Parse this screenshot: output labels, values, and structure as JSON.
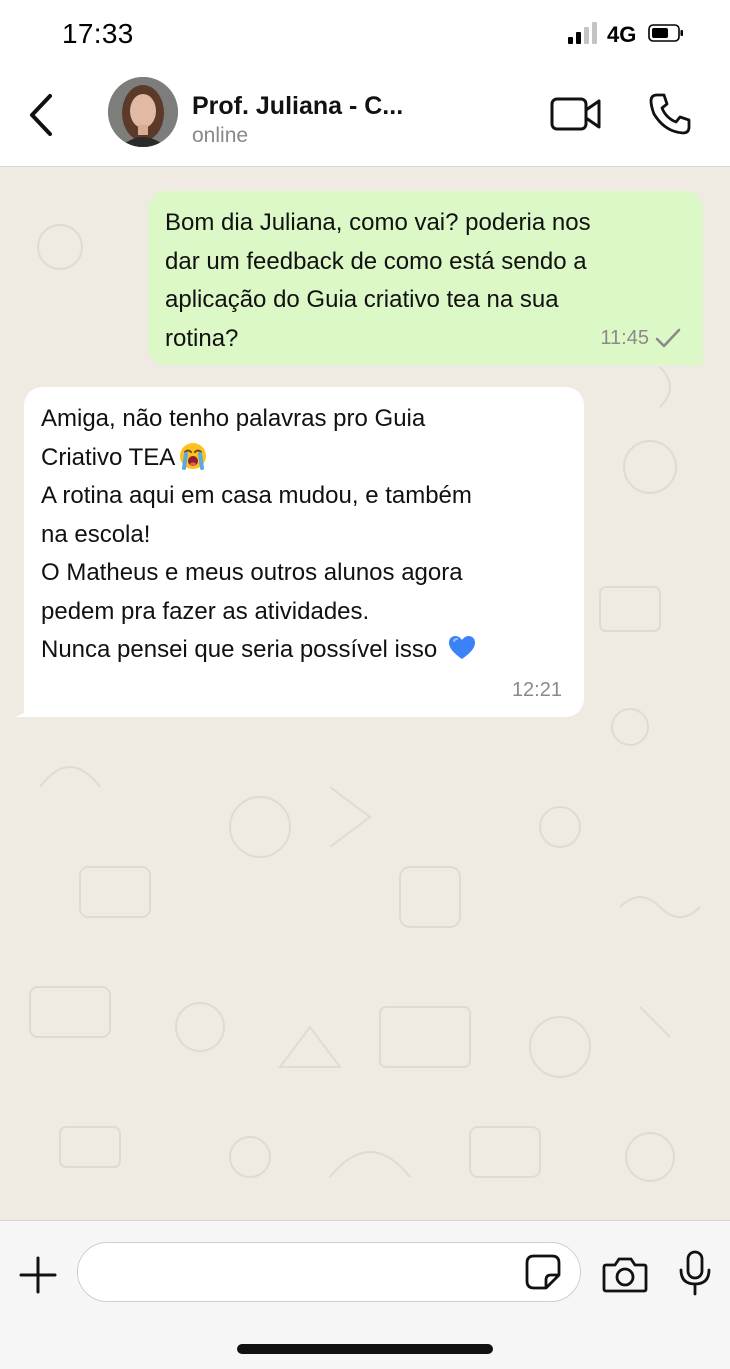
{
  "status_bar": {
    "time": "17:33",
    "network": "4G",
    "signal_icon": "signal-bars-icon",
    "battery_icon": "battery-icon"
  },
  "header": {
    "back_icon": "chevron-left-icon",
    "contact_name": "Prof. Juliana - C...",
    "contact_status": "online",
    "video_icon": "video-camera-icon",
    "call_icon": "phone-icon"
  },
  "messages": [
    {
      "direction": "outgoing",
      "lines": [
        "Bom dia Juliana, como vai? poderia nos",
        "dar um feedback de como está sendo a",
        "aplicação do Guia criativo tea na sua",
        "rotina?"
      ],
      "time": "11:45",
      "status_icon": "single-check-icon"
    },
    {
      "direction": "incoming",
      "lines": [
        "Amiga, não tenho palavras pro Guia",
        "Criativo TEA",
        "A rotina aqui em casa mudou, e também",
        "na escola!",
        "O Matheus e meus outros alunos agora",
        "pedem pra fazer as atividades.",
        "Nunca pensei que seria possível isso"
      ],
      "emojis": {
        "line_1": "loudly-crying-face-emoji",
        "line_6": "blue-heart-emoji"
      },
      "time": "12:21"
    }
  ],
  "input_bar": {
    "plus_icon": "plus-icon",
    "message_value": "",
    "message_placeholder": "",
    "sticker_icon": "sticker-icon",
    "camera_icon": "camera-icon",
    "mic_icon": "microphone-icon"
  },
  "colors": {
    "chat_background": "#efeae2",
    "outgoing_bubble": "#dcf8c6",
    "incoming_bubble": "#ffffff",
    "meta_text": "#8a8a8a"
  }
}
